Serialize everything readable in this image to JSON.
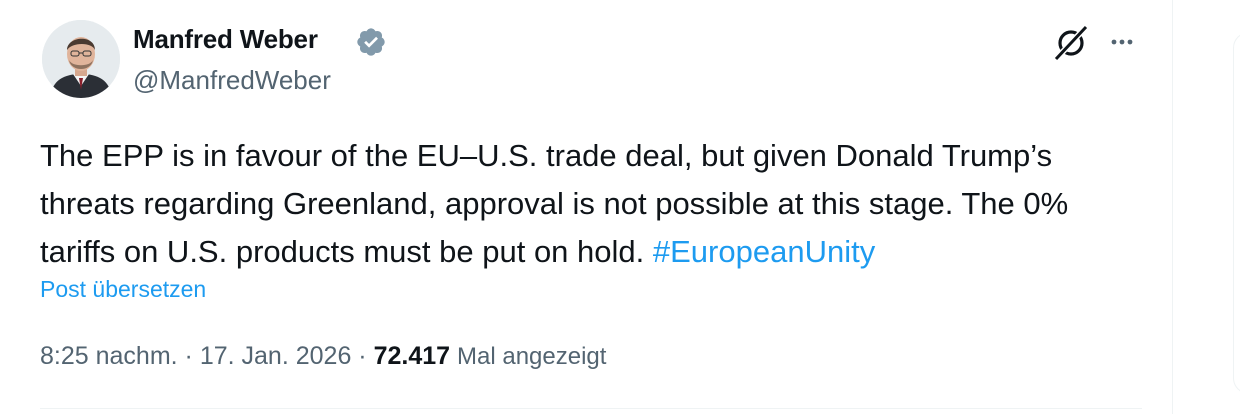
{
  "author": {
    "name": "Manfred Weber",
    "handle": "@ManfredWeber",
    "verified": true
  },
  "post": {
    "text_main": "The EPP is in favour of the EU–U.S. trade deal, but given Donald Trump’s threats regarding Greenland, approval is not possible at this stage. The 0% tariffs on U.S. products must be put on hold.",
    "hashtag": "#EuropeanUnity",
    "translate_label": "Post übersetzen"
  },
  "meta": {
    "time": "8:25 nachm.",
    "separator": "·",
    "date": "17. Jan. 2026",
    "views_count": "72.417",
    "views_label": "Mal angezeigt"
  },
  "icons": {
    "verified": "verified-badge-icon",
    "grok": "grok-icon",
    "more": "more-options-icon"
  },
  "colors": {
    "accent": "#1d9bf0",
    "text": "#0f1419",
    "secondary": "#536471"
  }
}
